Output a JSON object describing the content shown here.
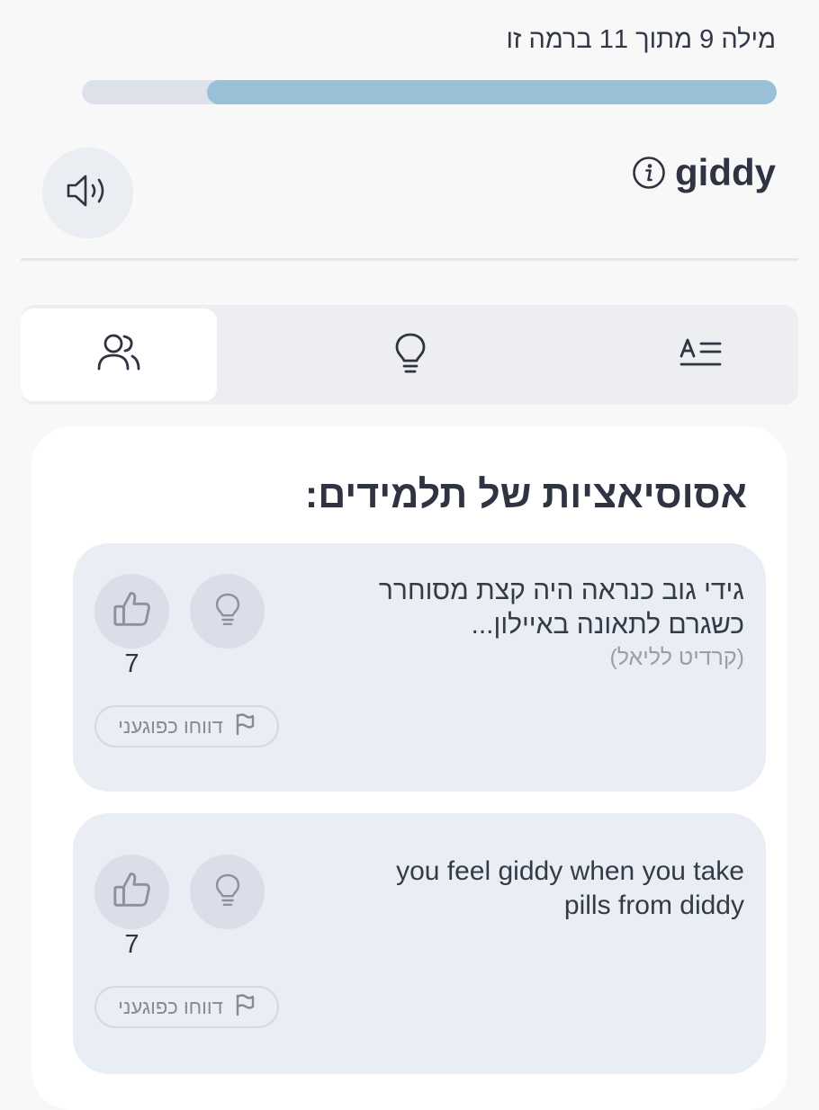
{
  "progress": {
    "label": "מילה 9 מתוך 11 ברמה זו",
    "current": 9,
    "total": 11,
    "fraction": 0.82
  },
  "word": {
    "title": "giddy",
    "info_icon": "info-icon",
    "sound_icon": "speaker-icon"
  },
  "tabs": [
    {
      "icon": "users-icon",
      "active": true
    },
    {
      "icon": "lightbulb-icon",
      "active": false
    },
    {
      "icon": "text-definition-icon",
      "active": false
    }
  ],
  "associations": {
    "title": "אסוסיאציות של תלמידים:",
    "items": [
      {
        "text": "גידי גוב כנראה היה קצת מסוחרר כשגרם לתאונה באיילון...",
        "credit": "(קרדיט לליאל)",
        "likes": "7",
        "report_label": "דווחו כפוגעני"
      },
      {
        "text": "you feel giddy when you take pills from diddy",
        "credit": "",
        "likes": "7",
        "report_label": "דווחו כפוגעני"
      }
    ]
  },
  "colors": {
    "progress_fill": "#98c0d6",
    "progress_track": "#dde2ea",
    "card_bg": "#e9edf4",
    "text": "#2f3342"
  }
}
